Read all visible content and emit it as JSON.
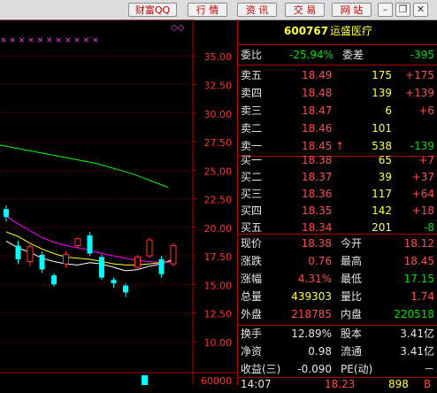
{
  "toolbar": {
    "buttons": [
      "财富QQ",
      "行 情",
      "资 讯",
      "交 易",
      "网 站"
    ],
    "window_controls": [
      "min-icon",
      "restore-icon",
      "close-icon"
    ]
  },
  "chart": {
    "price_axis": [
      "35.00",
      "32.50",
      "30.00",
      "27.50",
      "25.00",
      "22.50",
      "20.00",
      "17.50",
      "15.00",
      "12.50",
      "10.00",
      "60000"
    ],
    "colors": {
      "up": "#ff3232",
      "down": "#00ffff",
      "ma5": "#ffffff",
      "ma10": "#ffff00",
      "ma20": "#ff00ff",
      "ma60": "#00ff00",
      "grid": "#b00000"
    }
  },
  "chart_data": {
    "type": "candlestick",
    "ylim": [
      8.75,
      36.8
    ],
    "candles": [
      {
        "o": 21.6,
        "c": 20.9,
        "h": 21.9,
        "l": 20.5
      },
      {
        "o": 18.4,
        "c": 17.2,
        "h": 18.8,
        "l": 16.8
      },
      {
        "o": 17.0,
        "c": 18.3,
        "h": 18.6,
        "l": 16.6
      },
      {
        "o": 17.6,
        "c": 16.3,
        "h": 17.9,
        "l": 16.0
      },
      {
        "o": 15.8,
        "c": 15.0,
        "h": 16.0,
        "l": 14.8
      },
      {
        "o": 16.8,
        "c": 17.6,
        "h": 17.9,
        "l": 16.5
      },
      {
        "o": 18.4,
        "c": 19.0,
        "h": 19.1,
        "l": 18.2
      },
      {
        "o": 19.3,
        "c": 17.7,
        "h": 19.6,
        "l": 17.5
      },
      {
        "o": 17.4,
        "c": 15.6,
        "h": 17.6,
        "l": 15.4
      },
      {
        "o": 15.4,
        "c": 15.1,
        "h": 15.6,
        "l": 14.7
      },
      {
        "o": 14.9,
        "c": 14.3,
        "h": 15.1,
        "l": 13.9
      },
      {
        "o": 16.5,
        "c": 17.4,
        "h": 17.6,
        "l": 16.3
      },
      {
        "o": 17.5,
        "c": 18.9,
        "h": 19.1,
        "l": 17.3
      },
      {
        "o": 17.2,
        "c": 15.9,
        "h": 17.5,
        "l": 15.6
      },
      {
        "o": 16.8,
        "c": 18.4,
        "h": 18.6,
        "l": 16.6
      }
    ],
    "ma_series": [
      {
        "values": [
          18.8,
          18.2,
          17.8,
          17.3,
          17.0,
          16.8,
          16.7,
          16.9,
          16.8,
          16.5,
          16.2,
          16.3,
          16.6,
          16.8,
          17.2
        ]
      },
      {
        "values": [
          19.6,
          19.2,
          18.6,
          18.1,
          17.7,
          17.4,
          17.3,
          17.2,
          17.0,
          16.8,
          16.7,
          16.7,
          16.8,
          16.9,
          17.1
        ]
      },
      {
        "values": [
          21.0,
          20.3,
          19.7,
          19.1,
          18.7,
          18.4,
          18.2,
          18.0,
          17.7,
          17.5,
          17.3,
          17.1,
          17.0,
          16.9,
          17.0
        ]
      },
      {
        "values": [
          27.2,
          27.0,
          26.8,
          26.6,
          26.4,
          26.2,
          26.0,
          25.8,
          25.6,
          25.3,
          25.0,
          24.7,
          24.3,
          23.9,
          23.5
        ]
      }
    ]
  },
  "quote": {
    "code": "600767",
    "name": "运盛医疗",
    "weibi_label": "委比",
    "weibi_value": "-25.94%",
    "weicha_label": "委差",
    "weicha_value": "-395",
    "asks": [
      {
        "label": "卖五",
        "price": "18.49",
        "vol": "175",
        "chg": "+175"
      },
      {
        "label": "卖四",
        "price": "18.48",
        "vol": "139",
        "chg": "+139"
      },
      {
        "label": "卖三",
        "price": "18.47",
        "vol": "6",
        "chg": "+6"
      },
      {
        "label": "卖二",
        "price": "18.46",
        "vol": "101",
        "chg": ""
      },
      {
        "label": "卖一",
        "price": "18.45",
        "vol": "538",
        "chg": "-139",
        "arrow": "↑"
      }
    ],
    "bids": [
      {
        "label": "买一",
        "price": "18.38",
        "vol": "65",
        "chg": "+7"
      },
      {
        "label": "买二",
        "price": "18.37",
        "vol": "39",
        "chg": "+37"
      },
      {
        "label": "买三",
        "price": "18.36",
        "vol": "117",
        "chg": "+64"
      },
      {
        "label": "买四",
        "price": "18.35",
        "vol": "142",
        "chg": "+18"
      },
      {
        "label": "买五",
        "price": "18.34",
        "vol": "201",
        "chg": "-8"
      }
    ],
    "stats": [
      {
        "l1": "现价",
        "v1": "18.38",
        "l2": "今开",
        "v2": "18.12",
        "c1": "red",
        "c2": "red"
      },
      {
        "l1": "涨跌",
        "v1": "0.76",
        "l2": "最高",
        "v2": "18.45",
        "c1": "red",
        "c2": "red"
      },
      {
        "l1": "涨幅",
        "v1": "4.31%",
        "l2": "最低",
        "v2": "17.15",
        "c1": "red",
        "c2": "grn"
      },
      {
        "l1": "总量",
        "v1": "439303",
        "l2": "量比",
        "v2": "1.74",
        "c1": "ylw",
        "c2": "red"
      },
      {
        "l1": "外盘",
        "v1": "218785",
        "l2": "内盘",
        "v2": "220518",
        "c1": "red",
        "c2": "grn"
      }
    ],
    "fund": [
      {
        "l1": "换手",
        "v1": "12.89%",
        "l2": "股本",
        "v2": "3.41亿"
      },
      {
        "l1": "净资",
        "v1": "0.98",
        "l2": "流通",
        "v2": "3.41亿"
      },
      {
        "l1": "收益(三)",
        "v1": "-0.090",
        "l2": "PE(动)",
        "v2": "－"
      }
    ],
    "tick": {
      "time": "14:07",
      "price": "18.23",
      "vol": "898",
      "side": "B"
    }
  }
}
